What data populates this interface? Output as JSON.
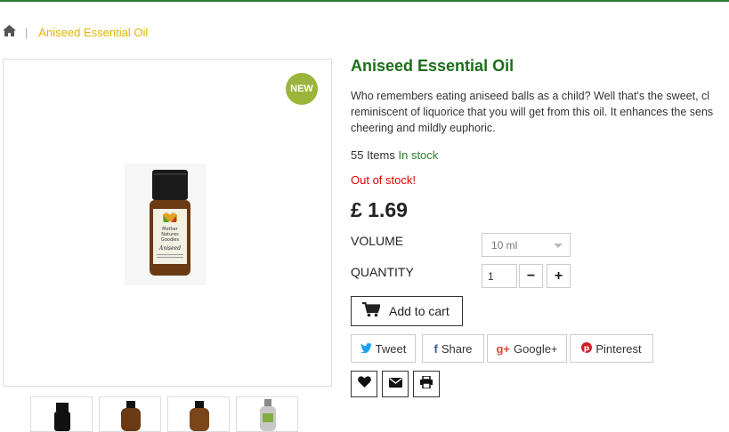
{
  "breadcrumb": {
    "home_icon": "home-icon",
    "current": "Aniseed Essential Oil"
  },
  "product": {
    "title": "Aniseed Essential Oil",
    "description_lines": [
      "Who remembers eating aniseed balls as a child? Well that's the sweet, cl",
      "reminiscent of liquorice that you will get from this oil. It enhances the sens",
      "cheering and mildly euphoric."
    ],
    "badge": "NEW",
    "stock_count": "55 Items",
    "stock_status": "In stock",
    "out_of_stock": "Out of stock!",
    "price": "£ 1.69",
    "bottle_label": {
      "brand_line1": "Mother",
      "brand_line2": "Natures",
      "brand_line3": "Goodies",
      "name": "Aniseed"
    }
  },
  "options": {
    "volume_label": "VOLUME",
    "volume_value": "10 ml",
    "quantity_label": "QUANTITY",
    "quantity_value": "1",
    "minus": "−",
    "plus": "+"
  },
  "actions": {
    "add_to_cart": "Add to cart"
  },
  "share": {
    "tweet": "Tweet",
    "share": "Share",
    "google": "Google+",
    "pinterest": "Pinterest"
  },
  "colors": {
    "brand_green": "#1b6e1b",
    "breadcrumb_gold": "#e0b400",
    "badge_green": "#9ab53a",
    "out_of_stock_red": "#dd0000"
  }
}
